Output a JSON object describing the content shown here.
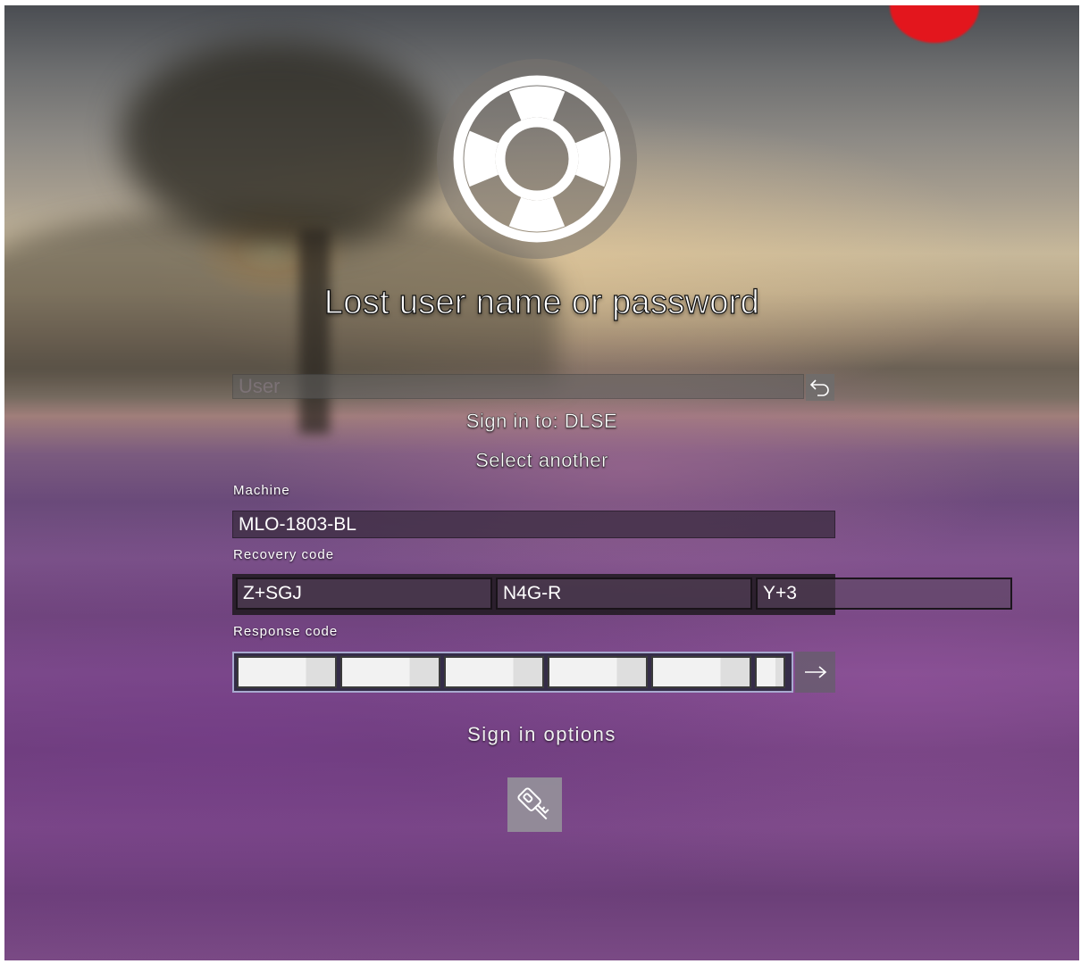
{
  "screen": {
    "title": "Lost user name or password",
    "hero_icon": "lifebuoy-icon"
  },
  "user": {
    "placeholder": "User",
    "value": "",
    "back_icon": "back-arrow-icon"
  },
  "sign_in": {
    "target": "Sign in to: DLSE",
    "select_another": "Select another"
  },
  "machine": {
    "label": "Machine",
    "value": "MLO-1803-BL"
  },
  "recovery": {
    "label": "Recovery code",
    "segments": [
      "Z+SGJ",
      "N4G-R",
      "Y+3"
    ]
  },
  "response": {
    "label": "Response code",
    "segments": [
      "",
      "",
      "",
      "",
      "",
      ""
    ],
    "submit_icon": "arrow-right-icon"
  },
  "options": {
    "label": "Sign in options",
    "key_icon": "key-icon"
  },
  "colors": {
    "accent_red": "#e3161d",
    "focus_border": "#a8a9cf"
  }
}
